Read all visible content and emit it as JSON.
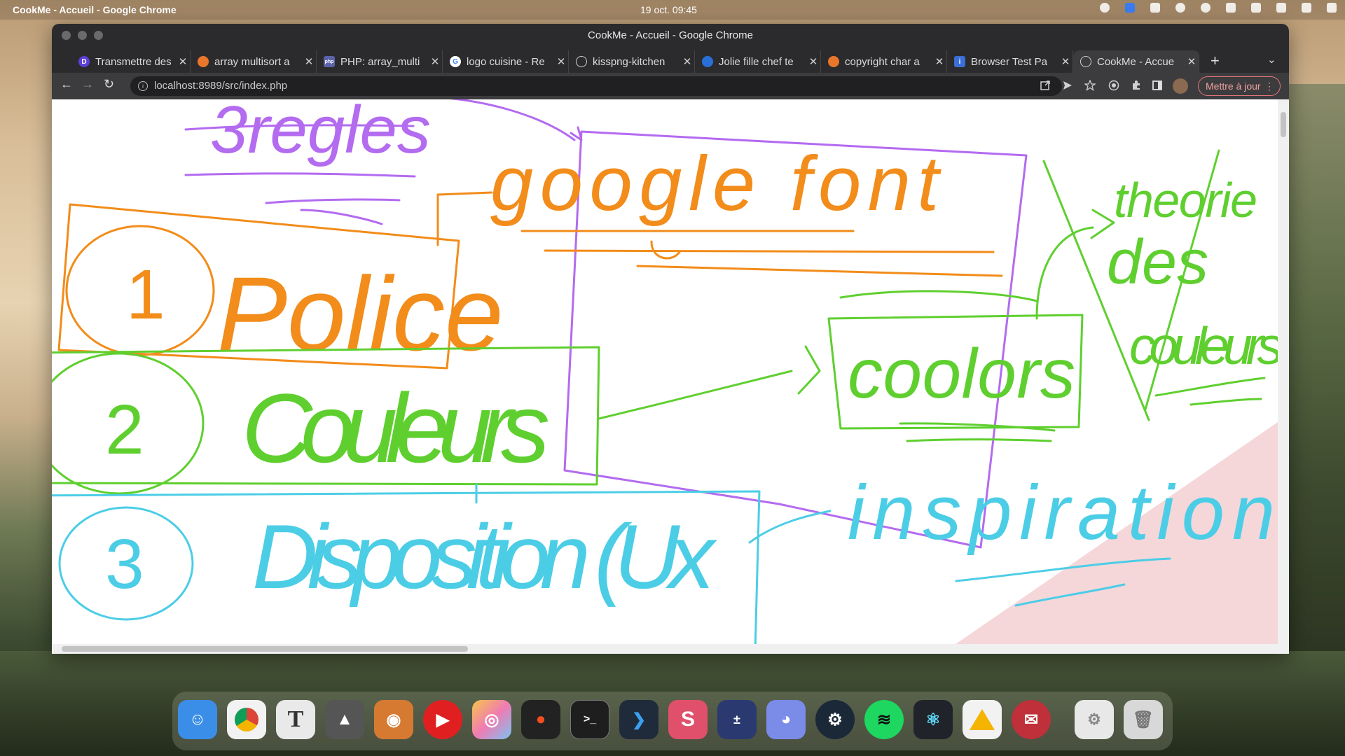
{
  "system": {
    "app_title": "CookMe - Accueil - Google Chrome",
    "clock": "19 oct.  09:45"
  },
  "window": {
    "title": "CookMe - Accueil - Google Chrome"
  },
  "tabs": [
    {
      "label": "Transmettre des",
      "icon": "d-app-icon",
      "color": "#5b3fd6"
    },
    {
      "label": "array multisort a",
      "icon": "stackoverflow-icon",
      "color": "#e8762b"
    },
    {
      "label": "PHP: array_multi",
      "icon": "php-icon",
      "color": "#5a63a8"
    },
    {
      "label": "logo cuisine - Re",
      "icon": "google-icon",
      "color": "#4285f4"
    },
    {
      "label": "kisspng-kitchen",
      "icon": "globe-icon",
      "color": "#cfcfcf"
    },
    {
      "label": "Jolie fille chef te",
      "icon": "shutterstock-icon",
      "color": "#2a6fd6"
    },
    {
      "label": "copyright char a",
      "icon": "stackoverflow-icon",
      "color": "#e8762b"
    },
    {
      "label": "Browser Test Pa",
      "icon": "info-icon",
      "color": "#3b6ed6"
    },
    {
      "label": "CookMe - Accue",
      "icon": "globe-icon",
      "color": "#cfcfcf",
      "active": true
    }
  ],
  "toolbar": {
    "url": "localhost:8989/src/index.php",
    "update_button": "Mettre à jour"
  },
  "drawing": {
    "heading": "3regles",
    "google_font": "google font",
    "police": "Police",
    "num1": "1",
    "couleurs": "Couleurs",
    "num2": "2",
    "coolors": "coolors",
    "disposition": "Disposition (Ux",
    "num3": "3",
    "inspiration": "inspiration",
    "theorie": "theorie",
    "des": "des",
    "couleurs_right": "couleurs",
    "colors": {
      "purple": "#b36bf0",
      "orange": "#f28c1a",
      "green": "#5fcf2f",
      "cyan": "#4ccde6",
      "pink": "#f5d7da"
    }
  },
  "dock": [
    {
      "name": "finder-icon",
      "color": "#3a8ee8"
    },
    {
      "name": "chrome-icon",
      "color": "#f2f2f2"
    },
    {
      "name": "typora-icon",
      "color": "#e9e9e9"
    },
    {
      "name": "inkscape-icon",
      "color": "#555555"
    },
    {
      "name": "gimp-icon",
      "color": "#d67a32"
    },
    {
      "name": "youtube-icon",
      "color": "#e02020"
    },
    {
      "name": "color-picker-icon",
      "color": "#f0c0d0"
    },
    {
      "name": "figma-icon",
      "color": "#222222"
    },
    {
      "name": "terminal-icon",
      "color": "#1e1e1e"
    },
    {
      "name": "vscode-icon",
      "color": "#1f2a3a"
    },
    {
      "name": "scrivener-icon",
      "color": "#e0506a"
    },
    {
      "name": "calculator-icon",
      "color": "#2a3a70"
    },
    {
      "name": "discord-icon",
      "color": "#7b8be8"
    },
    {
      "name": "steam-icon",
      "color": "#1b2838"
    },
    {
      "name": "spotify-icon",
      "color": "#1ed760"
    },
    {
      "name": "react-icon",
      "color": "#20232a"
    },
    {
      "name": "google-drive-icon",
      "color": "#f2f2f2"
    },
    {
      "name": "gmail-icon",
      "color": "#c0303a"
    },
    {
      "name": "script-file-icon",
      "color": "#e8e8e8"
    },
    {
      "name": "trash-icon",
      "color": "#d8d8d8"
    }
  ]
}
